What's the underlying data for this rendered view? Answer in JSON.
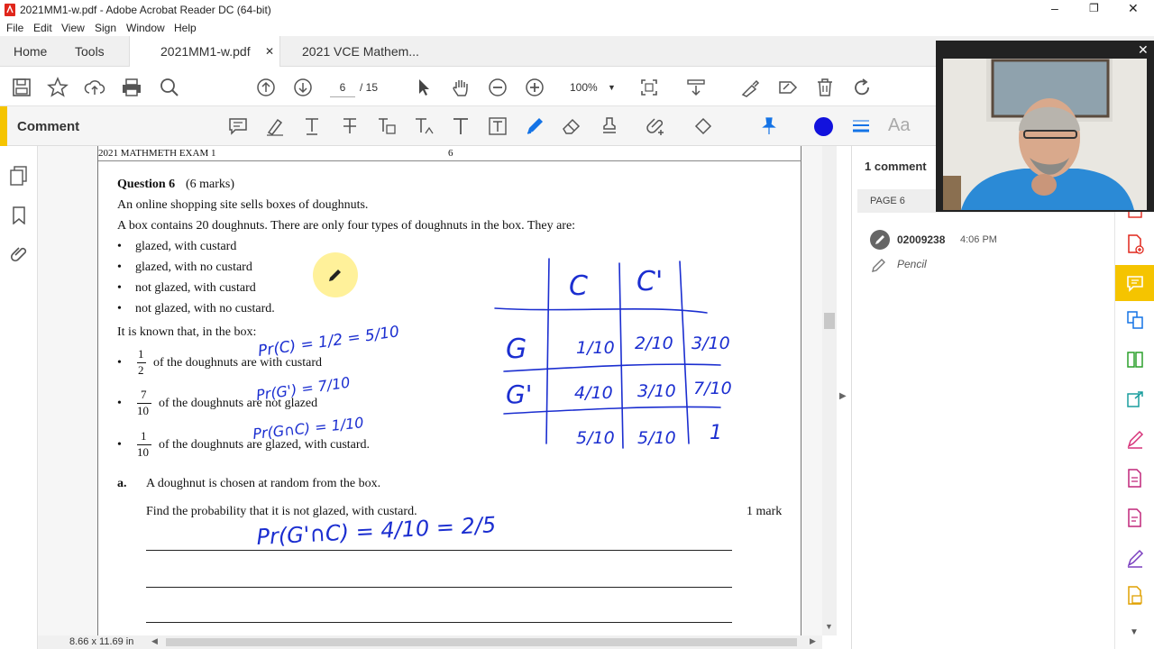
{
  "window": {
    "title": "2021MM1-w.pdf - Adobe Acrobat Reader DC (64-bit)"
  },
  "menu": [
    "File",
    "Edit",
    "View",
    "Sign",
    "Window",
    "Help"
  ],
  "tabs": {
    "home": "Home",
    "tools": "Tools",
    "doc1": "2021MM1-w.pdf",
    "doc2": "2021 VCE Mathem..."
  },
  "toolbar": {
    "page_current": "6",
    "page_total": "/ 15",
    "zoom": "100%"
  },
  "comment_bar": {
    "label": "Comment"
  },
  "page": {
    "header_left": "2021 MATHMETH EXAM 1",
    "header_num": "6",
    "question_title": "Question 6",
    "question_marks": "(6 marks)",
    "line1": "An online shopping site sells boxes of doughnuts.",
    "line2": "A box contains 20 doughnuts. There are only four types of doughnuts in the box. They are:",
    "types": [
      "glazed, with custard",
      "glazed, with no custard",
      "not glazed, with custard",
      "not glazed, with no custard."
    ],
    "known": "It is known that, in the box:",
    "facts": [
      {
        "num": "1",
        "den": "2",
        "text": "of the doughnuts are with custard"
      },
      {
        "num": "7",
        "den": "10",
        "text": "of the doughnuts are not glazed"
      },
      {
        "num": "1",
        "den": "10",
        "text": "of the doughnuts are glazed, with custard."
      }
    ],
    "part_a_label": "a.",
    "part_a_text": "A doughnut is chosen at random from the box.",
    "part_a_q": "Find the probability that it is not glazed, with custard.",
    "part_a_marks": "1 mark"
  },
  "handwriting": {
    "eq1": "Pr(C) = 1/2 = 5/10",
    "eq2": "Pr(G') = 7/10",
    "eq3": "Pr(G∩C) = 1/10",
    "answer": "Pr(G'∩C) = 4/10 = 2/5",
    "table_headers": [
      "C",
      "C'"
    ],
    "row_labels": [
      "G",
      "G'"
    ],
    "cells": [
      [
        "1/10",
        "2/10",
        "3/10"
      ],
      [
        "4/10",
        "3/10",
        "7/10"
      ],
      [
        "5/10",
        "5/10",
        "1"
      ]
    ]
  },
  "status": {
    "page_size": "8.66 x 11.69 in"
  },
  "comments_panel": {
    "count": "1 comment",
    "page_label": "PAGE 6",
    "author": "02009238",
    "time": "4:06 PM",
    "type": "Pencil"
  },
  "colors": {
    "accent": "#1473e6",
    "ink": "#1b2ed0",
    "comment_yellow": "#f5c400",
    "tab_active": "#ffffff"
  }
}
